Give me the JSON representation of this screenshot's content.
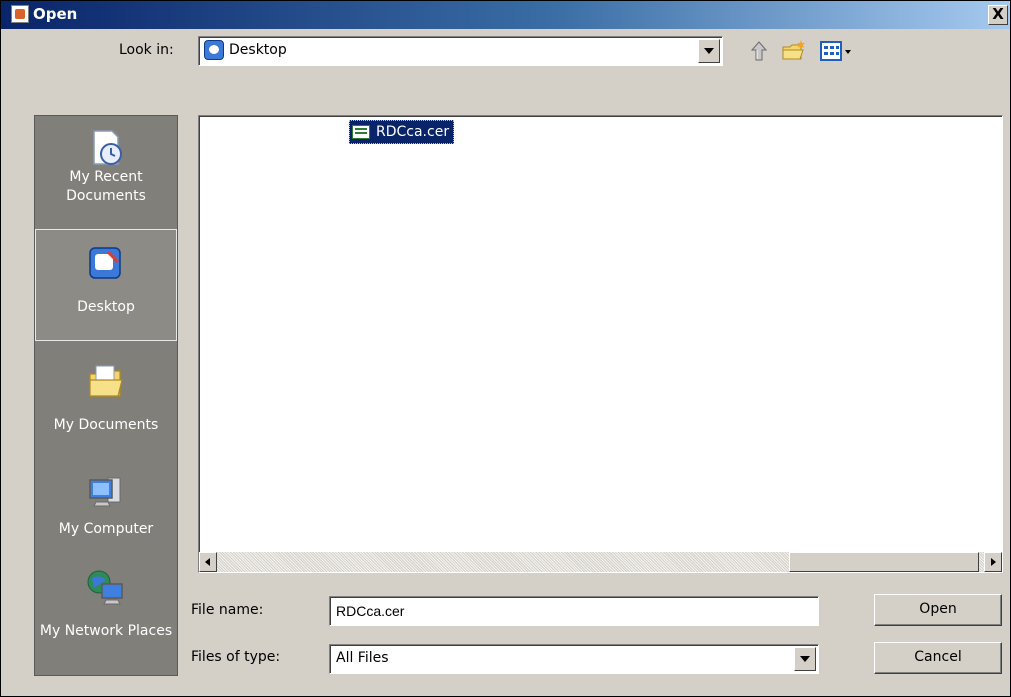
{
  "window": {
    "title": "Open",
    "close_glyph": "X"
  },
  "lookin": {
    "label": "Look in:",
    "value": "Desktop",
    "icon": "desktop-icon"
  },
  "toolbar": {
    "up_icon": "up-one-level-icon",
    "new_folder_icon": "new-folder-icon",
    "view_menu_icon": "view-menu-icon"
  },
  "places": [
    {
      "label": "My Recent Documents",
      "icon": "recent-documents-icon"
    },
    {
      "label": "Desktop",
      "icon": "desktop-icon",
      "selected": true
    },
    {
      "label": "My Documents",
      "icon": "my-documents-icon"
    },
    {
      "label": "My Computer",
      "icon": "my-computer-icon"
    },
    {
      "label": "My Network Places",
      "icon": "network-places-icon"
    }
  ],
  "files": [
    {
      "name": "RDCca.cer",
      "icon": "certificate-file-icon",
      "selected": true
    }
  ],
  "filename": {
    "label": "File name:",
    "value": "RDCca.cer"
  },
  "filetype": {
    "label": "Files of type:",
    "value": "All Files"
  },
  "buttons": {
    "open": "Open",
    "cancel": "Cancel"
  },
  "colors": {
    "title_bar": "#0a246a",
    "selection": "#0a246a",
    "dialog_bg": "#d4d0c8",
    "places_bg": "#807f7a"
  }
}
